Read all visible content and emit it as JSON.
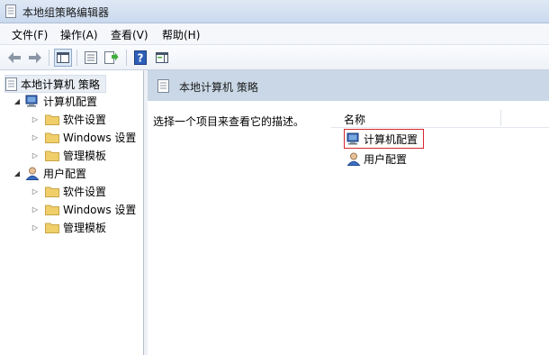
{
  "window": {
    "title": "本地组策略编辑器"
  },
  "menu": {
    "items": [
      {
        "label": "文件(F)"
      },
      {
        "label": "操作(A)"
      },
      {
        "label": "查看(V)"
      },
      {
        "label": "帮助(H)"
      }
    ]
  },
  "toolbar": {
    "buttons": [
      "back-arrow-icon",
      "forward-arrow-icon",
      "console-tree-icon",
      "properties-icon",
      "export-list-icon",
      "help-icon",
      "show-hide-action-pane-icon"
    ]
  },
  "tree": {
    "root": "本地计算机 策略",
    "computer": {
      "label": "计算机配置",
      "children": [
        "软件设置",
        "Windows 设置",
        "管理模板"
      ]
    },
    "user": {
      "label": "用户配置",
      "children": [
        "软件设置",
        "Windows 设置",
        "管理模板"
      ]
    }
  },
  "right": {
    "header_title": "本地计算机 策略",
    "description": "选择一个项目来查看它的描述。",
    "column_name": "名称",
    "items": [
      {
        "label": "计算机配置",
        "selected": true
      },
      {
        "label": "用户配置",
        "selected": false
      }
    ]
  },
  "colors": {
    "header_band": "#c9d7e6",
    "selection_outline": "#d9262f",
    "folder": "#f0cf6b"
  }
}
